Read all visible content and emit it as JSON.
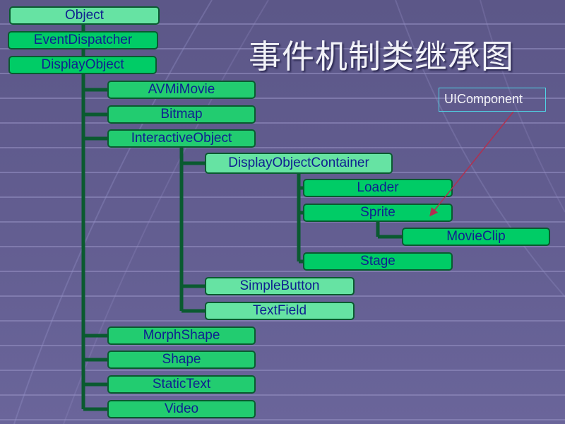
{
  "title": "事件机制类继承图",
  "annotation": {
    "label": "UIComponent",
    "points_to": "Sprite",
    "arrow_color": "#b03050",
    "border_color": "#4fd6e6"
  },
  "colors": {
    "node_fill": "#00cc66",
    "node_fill_light": "#66e3a3",
    "node_border": "#0a5a30",
    "node_text": "#102090",
    "connector": "#0a5a30"
  },
  "nodes": [
    {
      "id": "object",
      "label": "Object",
      "parent": null
    },
    {
      "id": "eventdispatcher",
      "label": "EventDispatcher",
      "parent": "object"
    },
    {
      "id": "displayobject",
      "label": "DisplayObject",
      "parent": "eventdispatcher"
    },
    {
      "id": "avmimovie",
      "label": "AVMiMovie",
      "parent": "displayobject"
    },
    {
      "id": "bitmap",
      "label": "Bitmap",
      "parent": "displayobject"
    },
    {
      "id": "interactiveobject",
      "label": "InteractiveObject",
      "parent": "displayobject"
    },
    {
      "id": "displayobjectcontainer",
      "label": "DisplayObjectContainer",
      "parent": "interactiveobject"
    },
    {
      "id": "loader",
      "label": "Loader",
      "parent": "displayobjectcontainer"
    },
    {
      "id": "sprite",
      "label": "Sprite",
      "parent": "displayobjectcontainer"
    },
    {
      "id": "movieclip",
      "label": "MovieClip",
      "parent": "sprite"
    },
    {
      "id": "stage",
      "label": "Stage",
      "parent": "displayobjectcontainer"
    },
    {
      "id": "simplebutton",
      "label": "SimpleButton",
      "parent": "interactiveobject"
    },
    {
      "id": "textfield",
      "label": "TextField",
      "parent": "interactiveobject"
    },
    {
      "id": "morphshape",
      "label": "MorphShape",
      "parent": "displayobject"
    },
    {
      "id": "shape",
      "label": "Shape",
      "parent": "displayobject"
    },
    {
      "id": "statictext",
      "label": "StaticText",
      "parent": "displayobject"
    },
    {
      "id": "video",
      "label": "Video",
      "parent": "displayobject"
    }
  ]
}
